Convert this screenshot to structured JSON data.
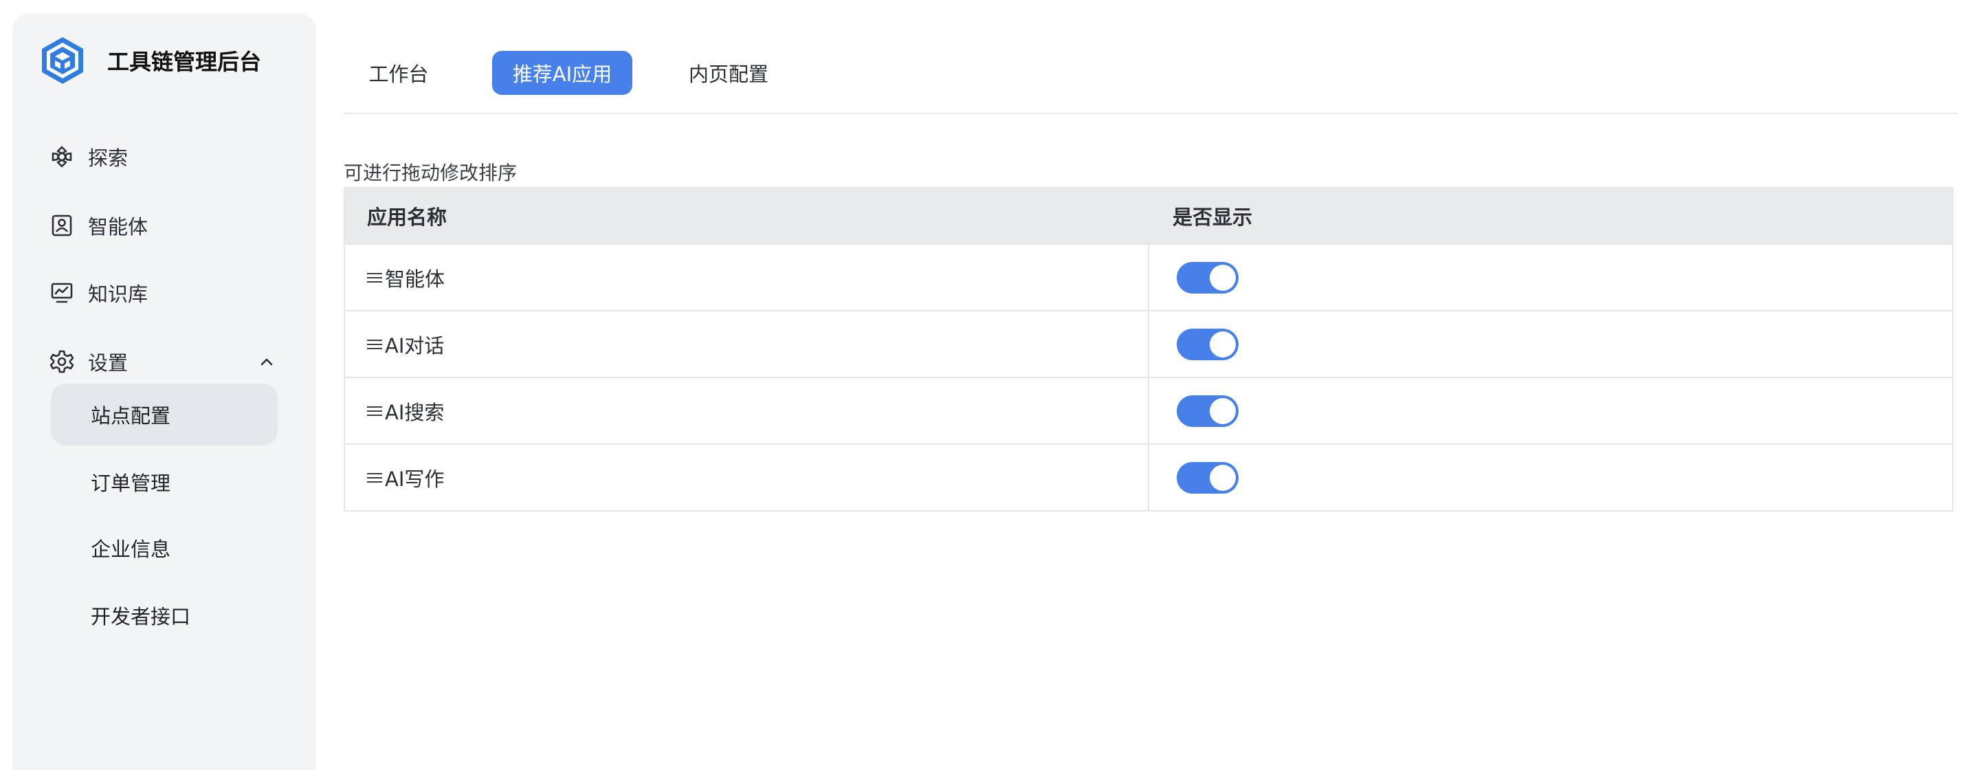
{
  "app": {
    "title": "工具链管理后台"
  },
  "sidebar": {
    "items": [
      {
        "label": "探索",
        "icon": "explore-icon"
      },
      {
        "label": "智能体",
        "icon": "agent-icon"
      },
      {
        "label": "知识库",
        "icon": "knowledge-icon"
      },
      {
        "label": "设置",
        "icon": "settings-icon",
        "expanded": true
      }
    ],
    "sub_items": [
      {
        "label": "站点配置",
        "active": true
      },
      {
        "label": "订单管理",
        "active": false
      },
      {
        "label": "企业信息",
        "active": false
      },
      {
        "label": "开发者接口",
        "active": false
      }
    ]
  },
  "tabs": [
    {
      "label": "工作台",
      "active": false
    },
    {
      "label": "推荐AI应用",
      "active": true
    },
    {
      "label": "内页配置",
      "active": false
    }
  ],
  "hint": "可进行拖动修改排序",
  "table": {
    "columns": [
      "应用名称",
      "是否显示"
    ],
    "rows": [
      {
        "name": "智能体",
        "visible": true
      },
      {
        "name": "AI对话",
        "visible": true
      },
      {
        "name": "AI搜索",
        "visible": true
      },
      {
        "name": "AI写作",
        "visible": true
      }
    ]
  },
  "colors": {
    "accent": "#4680e8",
    "sidebar_bg": "#f3f4f6",
    "active_sub_bg": "#e4e6ea",
    "table_header_bg": "#e9eaec"
  }
}
